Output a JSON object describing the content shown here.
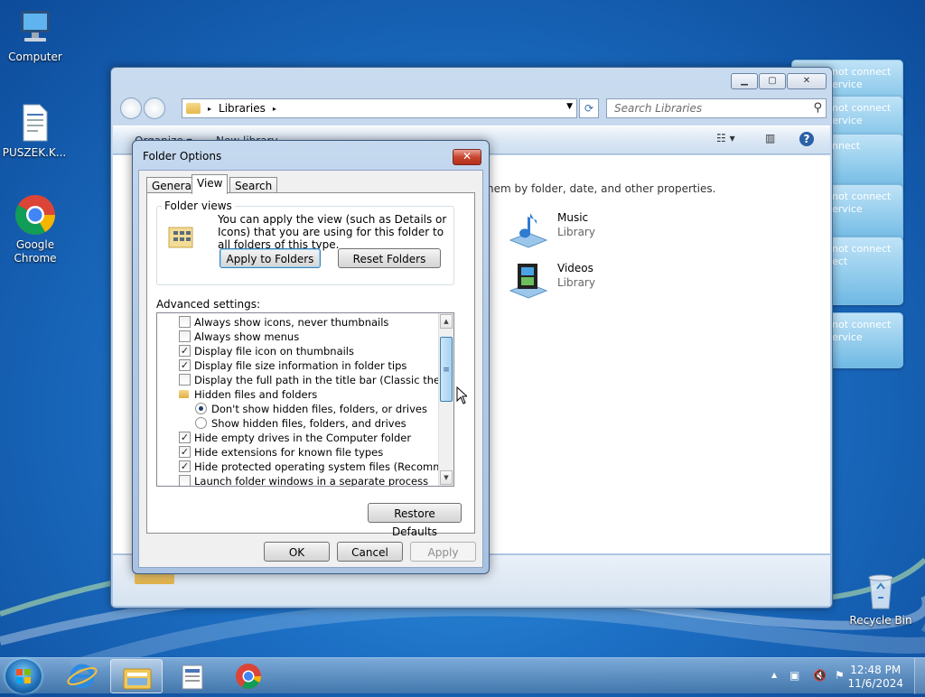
{
  "desktop": {
    "icons": [
      {
        "name": "computer",
        "label": "Computer"
      },
      {
        "name": "puszek",
        "label": "PUSZEK.K..."
      },
      {
        "name": "chrome",
        "label": "Google Chrome"
      },
      {
        "name": "recycle",
        "label": "Recycle Bin"
      }
    ],
    "popups": {
      "text1": "not connect",
      "text2": "ervice",
      "text3": "nnect",
      "text4": "ect"
    }
  },
  "explorer": {
    "address": {
      "root_arrow": "▸",
      "crumb": "Libraries",
      "crumb_arrow": "▸"
    },
    "search_placeholder": "Search Libraries",
    "cmdbar": {
      "organize": "Organize ▾",
      "new_library": "New library"
    },
    "hint": "hem by folder, date, and other properties.",
    "libraries": [
      {
        "name": "Music",
        "type": "Library"
      },
      {
        "name": "Videos",
        "type": "Library"
      }
    ]
  },
  "dialog": {
    "title": "Folder Options",
    "close": "✕",
    "tabs": [
      "General",
      "View",
      "Search"
    ],
    "active_tab": "View",
    "folder_views": {
      "legend": "Folder views",
      "text": "You can apply the view (such as Details or Icons) that you are using for this folder to all folders of this type.",
      "apply_button": "Apply to Folders",
      "reset_button": "Reset Folders"
    },
    "advanced_label": "Advanced settings:",
    "advanced_items": [
      {
        "kind": "checkbox",
        "checked": false,
        "label": "Always show icons, never thumbnails"
      },
      {
        "kind": "checkbox",
        "checked": false,
        "label": "Always show menus"
      },
      {
        "kind": "checkbox",
        "checked": true,
        "label": "Display file icon on thumbnails"
      },
      {
        "kind": "checkbox",
        "checked": true,
        "label": "Display file size information in folder tips"
      },
      {
        "kind": "checkbox",
        "checked": false,
        "label": "Display the full path in the title bar (Classic theme only)"
      },
      {
        "kind": "folder",
        "label": "Hidden files and folders"
      },
      {
        "kind": "radio",
        "checked": true,
        "label": "Don't show hidden files, folders, or drives"
      },
      {
        "kind": "radio",
        "checked": false,
        "label": "Show hidden files, folders, and drives"
      },
      {
        "kind": "checkbox",
        "checked": true,
        "label": "Hide empty drives in the Computer folder"
      },
      {
        "kind": "checkbox",
        "checked": true,
        "label": "Hide extensions for known file types"
      },
      {
        "kind": "checkbox",
        "checked": true,
        "label": "Hide protected operating system files (Recommended)"
      },
      {
        "kind": "checkbox",
        "checked": false,
        "label": "Launch folder windows in a separate process"
      }
    ],
    "check_mark": "✓",
    "restore_defaults": "Restore Defaults",
    "ok": "OK",
    "cancel": "Cancel",
    "apply": "Apply"
  },
  "taskbar": {
    "time": "12:48 PM",
    "date": "11/6/2024",
    "tray_arrow": "▲"
  },
  "colors": {
    "accent": "#3c7fb1",
    "close_red": "#c7452f"
  }
}
